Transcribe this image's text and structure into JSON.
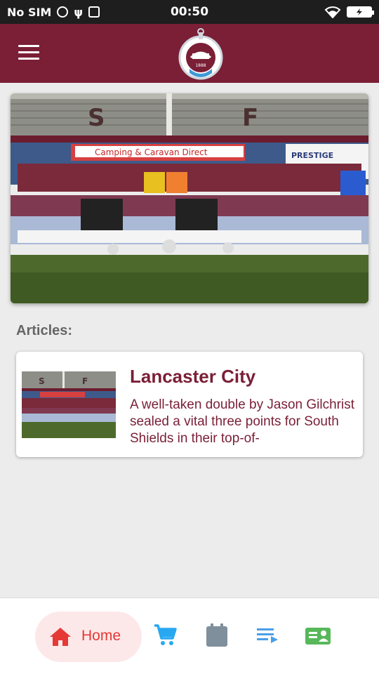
{
  "status_bar": {
    "carrier": "No SIM",
    "time": "00:50"
  },
  "header": {
    "menu_icon": "hamburger-menu-icon",
    "logo_alt": "South Shields FC crest",
    "crest_text_top": "SOUTH SHIELDS F.C.",
    "crest_text_banner": "ALWAYS READY",
    "crest_year": "1888"
  },
  "hero": {
    "image_desc": "team-photo",
    "banner_left_letter": "S",
    "banner_right_letter": "F",
    "ad_text": "Camping & Caravan Direct",
    "ad_text_2": "PRESTIGE"
  },
  "articles": {
    "heading": "Articles:",
    "items": [
      {
        "title": "Lancaster City",
        "snippet": "A well-taken double by Jason Gilchrist sealed a vital three points for South Shields in their top-of-"
      }
    ]
  },
  "bottom_nav": {
    "home_label": "Home",
    "items": [
      {
        "icon": "home-icon",
        "label": "Home",
        "active": true
      },
      {
        "icon": "cart-icon"
      },
      {
        "icon": "calendar-icon"
      },
      {
        "icon": "playlist-icon"
      },
      {
        "icon": "contact-card-icon"
      }
    ]
  },
  "colors": {
    "brand": "#7a1f36",
    "active": "#e53935",
    "active_bg": "#fde8e9",
    "cart": "#29a8f2",
    "calendar": "#7f8f9c",
    "playlist": "#4a9ee8",
    "contact": "#57b85a"
  }
}
